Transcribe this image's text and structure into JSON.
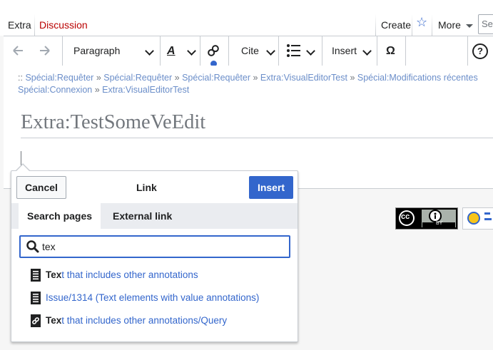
{
  "tabs": {
    "extra": "Extra",
    "discussion": "Discussion",
    "create": "Create",
    "more": "More"
  },
  "search": {
    "placeholder": "Sea"
  },
  "toolbar": {
    "paragraph": "Paragraph",
    "cite": "Cite",
    "insert": "Insert",
    "special_char": "Ω"
  },
  "breadcrumbs": {
    "prefix": "::",
    "items": [
      "Spécial:Requêter",
      "Spécial:Requêter",
      "Spécial:Requêter",
      "Extra:VisualEditorTest",
      "Spécial:Modifications récentes"
    ],
    "line2": [
      "Spécial:Connexion",
      "Extra:VisualEditorTest"
    ],
    "separator": "»"
  },
  "page": {
    "title": "Extra:TestSomeVeEdit"
  },
  "link_dialog": {
    "cancel": "Cancel",
    "title": "Link",
    "insert": "Insert",
    "tab_search": "Search pages",
    "tab_external": "External link",
    "query": "tex",
    "results": [
      {
        "match": "Tex",
        "rest": "t that includes other annotations"
      },
      {
        "match": "",
        "rest": "Issue/1314 (Text elements with value annotations)"
      },
      {
        "match": "Tex",
        "rest": "t that includes other annotations/Query"
      }
    ]
  },
  "footer": {
    "cc_label": "BY"
  },
  "colors": {
    "accent": "#3366cc",
    "discussion_red": "#ba0000"
  }
}
